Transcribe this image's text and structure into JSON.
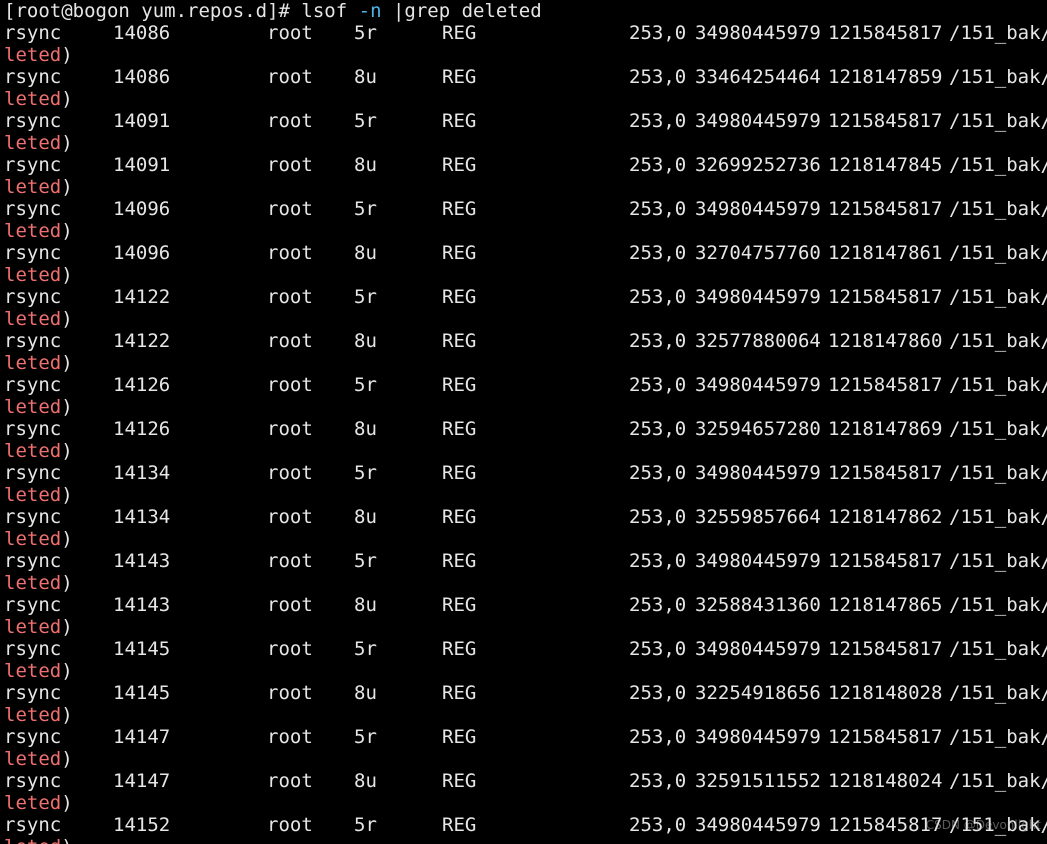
{
  "terminal": {
    "prompt": "[root@bogon yum.repos.d]# ",
    "cmd_main": "lsof ",
    "cmd_flag": "-n",
    "cmd_rest": " |grep deleted",
    "wrap_red": "leted",
    "wrap_tail": ")",
    "flag_color": "#4fb3e8",
    "wrap_color": "#f07070",
    "rows": [
      {
        "cmd": "rsync",
        "pid": "14086",
        "user": "root",
        "fd": "5r",
        "type": "REG",
        "dev": "253,0",
        "size": "34980445979",
        "node": "1215845817",
        "name": "/151_bak/"
      },
      {
        "cmd": "rsync",
        "pid": "14086",
        "user": "root",
        "fd": "8u",
        "type": "REG",
        "dev": "253,0",
        "size": "33464254464",
        "node": "1218147859",
        "name": "/151_bak/"
      },
      {
        "cmd": "rsync",
        "pid": "14091",
        "user": "root",
        "fd": "5r",
        "type": "REG",
        "dev": "253,0",
        "size": "34980445979",
        "node": "1215845817",
        "name": "/151_bak/"
      },
      {
        "cmd": "rsync",
        "pid": "14091",
        "user": "root",
        "fd": "8u",
        "type": "REG",
        "dev": "253,0",
        "size": "32699252736",
        "node": "1218147845",
        "name": "/151_bak/"
      },
      {
        "cmd": "rsync",
        "pid": "14096",
        "user": "root",
        "fd": "5r",
        "type": "REG",
        "dev": "253,0",
        "size": "34980445979",
        "node": "1215845817",
        "name": "/151_bak/"
      },
      {
        "cmd": "rsync",
        "pid": "14096",
        "user": "root",
        "fd": "8u",
        "type": "REG",
        "dev": "253,0",
        "size": "32704757760",
        "node": "1218147861",
        "name": "/151_bak/"
      },
      {
        "cmd": "rsync",
        "pid": "14122",
        "user": "root",
        "fd": "5r",
        "type": "REG",
        "dev": "253,0",
        "size": "34980445979",
        "node": "1215845817",
        "name": "/151_bak/"
      },
      {
        "cmd": "rsync",
        "pid": "14122",
        "user": "root",
        "fd": "8u",
        "type": "REG",
        "dev": "253,0",
        "size": "32577880064",
        "node": "1218147860",
        "name": "/151_bak/"
      },
      {
        "cmd": "rsync",
        "pid": "14126",
        "user": "root",
        "fd": "5r",
        "type": "REG",
        "dev": "253,0",
        "size": "34980445979",
        "node": "1215845817",
        "name": "/151_bak/"
      },
      {
        "cmd": "rsync",
        "pid": "14126",
        "user": "root",
        "fd": "8u",
        "type": "REG",
        "dev": "253,0",
        "size": "32594657280",
        "node": "1218147869",
        "name": "/151_bak/"
      },
      {
        "cmd": "rsync",
        "pid": "14134",
        "user": "root",
        "fd": "5r",
        "type": "REG",
        "dev": "253,0",
        "size": "34980445979",
        "node": "1215845817",
        "name": "/151_bak/"
      },
      {
        "cmd": "rsync",
        "pid": "14134",
        "user": "root",
        "fd": "8u",
        "type": "REG",
        "dev": "253,0",
        "size": "32559857664",
        "node": "1218147862",
        "name": "/151_bak/"
      },
      {
        "cmd": "rsync",
        "pid": "14143",
        "user": "root",
        "fd": "5r",
        "type": "REG",
        "dev": "253,0",
        "size": "34980445979",
        "node": "1215845817",
        "name": "/151_bak/"
      },
      {
        "cmd": "rsync",
        "pid": "14143",
        "user": "root",
        "fd": "8u",
        "type": "REG",
        "dev": "253,0",
        "size": "32588431360",
        "node": "1218147865",
        "name": "/151_bak/"
      },
      {
        "cmd": "rsync",
        "pid": "14145",
        "user": "root",
        "fd": "5r",
        "type": "REG",
        "dev": "253,0",
        "size": "34980445979",
        "node": "1215845817",
        "name": "/151_bak/"
      },
      {
        "cmd": "rsync",
        "pid": "14145",
        "user": "root",
        "fd": "8u",
        "type": "REG",
        "dev": "253,0",
        "size": "32254918656",
        "node": "1218148028",
        "name": "/151_bak/"
      },
      {
        "cmd": "rsync",
        "pid": "14147",
        "user": "root",
        "fd": "5r",
        "type": "REG",
        "dev": "253,0",
        "size": "34980445979",
        "node": "1215845817",
        "name": "/151_bak/"
      },
      {
        "cmd": "rsync",
        "pid": "14147",
        "user": "root",
        "fd": "8u",
        "type": "REG",
        "dev": "253,0",
        "size": "32591511552",
        "node": "1218148024",
        "name": "/151_bak/"
      },
      {
        "cmd": "rsync",
        "pid": "14152",
        "user": "root",
        "fd": "5r",
        "type": "REG",
        "dev": "253,0",
        "size": "34980445979",
        "node": "1215845817",
        "name": "/151_bak/"
      }
    ]
  },
  "watermark": "CSDN @Devonlight"
}
